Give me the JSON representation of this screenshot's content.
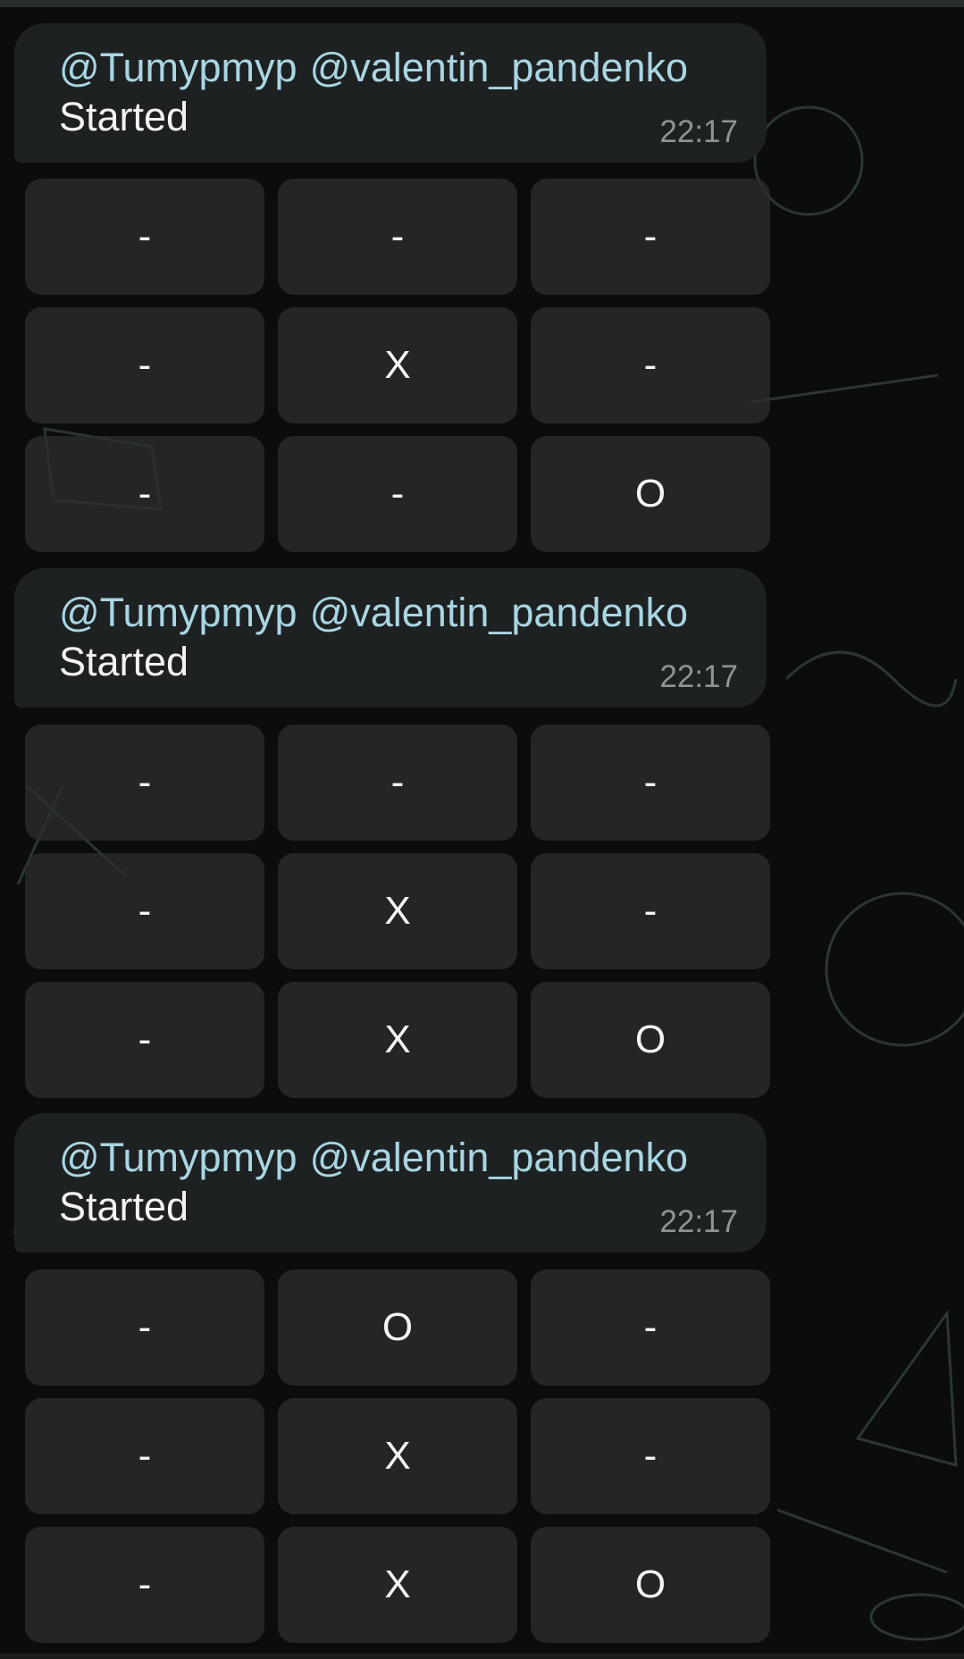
{
  "messages": [
    {
      "mentions": [
        "@Tumypmyp",
        "@valentin_pandenko"
      ],
      "status": "Started",
      "time": "22:17",
      "board": [
        [
          "-",
          "-",
          "-"
        ],
        [
          "-",
          "X",
          "-"
        ],
        [
          "-",
          "-",
          "O"
        ]
      ]
    },
    {
      "mentions": [
        "@Tumypmyp",
        "@valentin_pandenko"
      ],
      "status": "Started",
      "time": "22:17",
      "board": [
        [
          "-",
          "-",
          "-"
        ],
        [
          "-",
          "X",
          "-"
        ],
        [
          "-",
          "X",
          "O"
        ]
      ]
    },
    {
      "mentions": [
        "@Tumypmyp",
        "@valentin_pandenko"
      ],
      "status": "Started",
      "time": "22:17",
      "board": [
        [
          "-",
          "O",
          "-"
        ],
        [
          "-",
          "X",
          "-"
        ],
        [
          "-",
          "X",
          "O"
        ]
      ]
    }
  ],
  "colors": {
    "background": "#0b0d0c",
    "bubble": "#1e2122",
    "mention": "#a9d6e3",
    "timestamp": "#8e9396",
    "cell": "#2a2d2e"
  }
}
